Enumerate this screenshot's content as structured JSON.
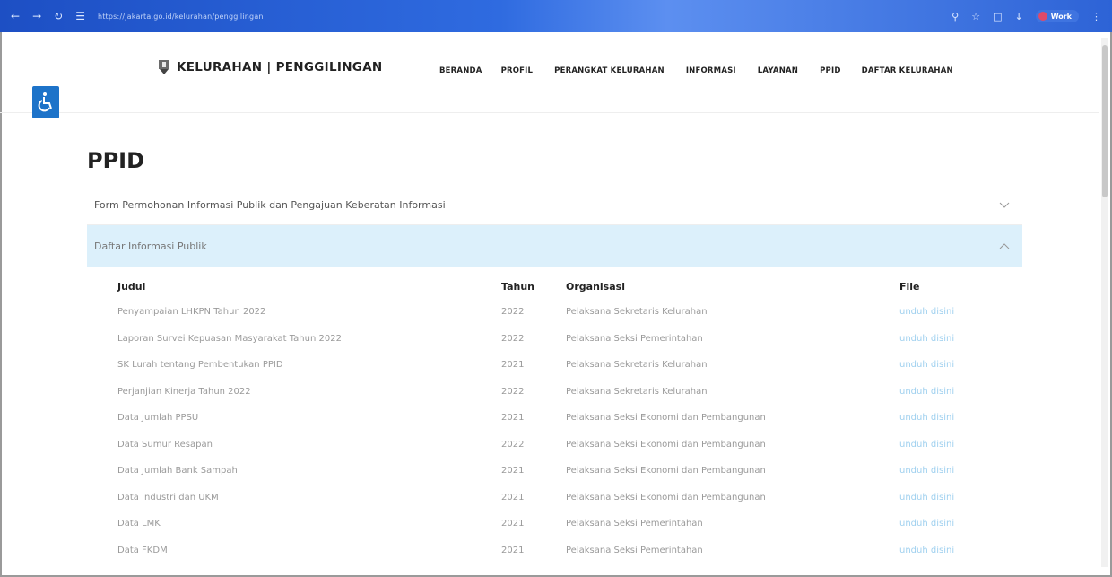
{
  "browser": {
    "url": "https://jakarta.go.id/kelurahan/penggilingan",
    "profile_label": "Work"
  },
  "header": {
    "brand": "KELURAHAN | PENGGILINGAN",
    "menu": [
      "BERANDA",
      "PROFIL",
      "PERANGKAT KELURAHAN",
      "INFORMASI",
      "LAYANAN",
      "PPID",
      "DAFTAR KELURAHAN"
    ]
  },
  "page": {
    "title": "PPID",
    "accordion": [
      {
        "label": "Form Permohonan Informasi Publik dan Pengajuan Keberatan Informasi",
        "expanded": false
      },
      {
        "label": "Daftar Informasi Publik",
        "expanded": true
      }
    ]
  },
  "table": {
    "headers": [
      "Judul",
      "Tahun",
      "Organisasi",
      "File"
    ],
    "rows": [
      {
        "judul": "Penyampaian LHKPN Tahun 2022",
        "tahun": "2022",
        "organisasi": "Pelaksana Sekretaris Kelurahan",
        "file": "unduh disini"
      },
      {
        "judul": "Laporan Survei Kepuasan Masyarakat Tahun 2022",
        "tahun": "2022",
        "organisasi": "Pelaksana Seksi Pemerintahan",
        "file": "unduh disini"
      },
      {
        "judul": "SK Lurah tentang Pembentukan PPID",
        "tahun": "2021",
        "organisasi": "Pelaksana Sekretaris Kelurahan",
        "file": "unduh disini"
      },
      {
        "judul": "Perjanjian Kinerja Tahun 2022",
        "tahun": "2022",
        "organisasi": "Pelaksana Sekretaris Kelurahan",
        "file": "unduh disini"
      },
      {
        "judul": "Data Jumlah PPSU",
        "tahun": "2021",
        "organisasi": "Pelaksana Seksi Ekonomi dan Pembangunan",
        "file": "unduh disini"
      },
      {
        "judul": "Data Sumur Resapan",
        "tahun": "2022",
        "organisasi": "Pelaksana Seksi Ekonomi dan Pembangunan",
        "file": "unduh disini"
      },
      {
        "judul": "Data Jumlah Bank Sampah",
        "tahun": "2021",
        "organisasi": "Pelaksana Seksi Ekonomi dan Pembangunan",
        "file": "unduh disini"
      },
      {
        "judul": "Data Industri dan UKM",
        "tahun": "2021",
        "organisasi": "Pelaksana Seksi Ekonomi dan Pembangunan",
        "file": "unduh disini"
      },
      {
        "judul": "Data LMK",
        "tahun": "2021",
        "organisasi": "Pelaksana Seksi Pemerintahan",
        "file": "unduh disini"
      },
      {
        "judul": "Data FKDM",
        "tahun": "2021",
        "organisasi": "Pelaksana Seksi Pemerintahan",
        "file": "unduh disini"
      }
    ]
  },
  "colors": {
    "accent": "#1d73c9",
    "accordion_active_bg": "#dcf0fb",
    "link": "#9fd0ef"
  }
}
